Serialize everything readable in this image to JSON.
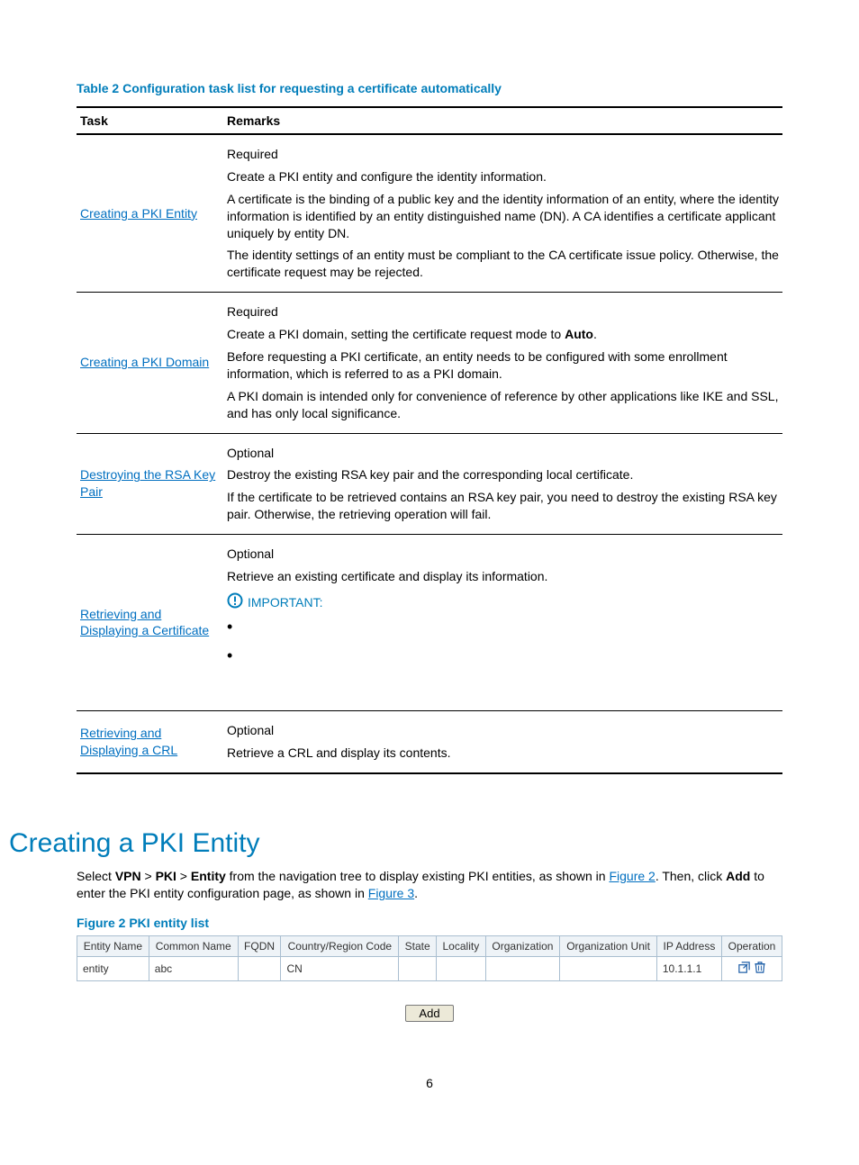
{
  "table_caption": "Table 2 Configuration task list for requesting a certificate automatically",
  "headers": {
    "task": "Task",
    "remarks": "Remarks"
  },
  "rows": {
    "r1": {
      "task": "Creating a PKI Entity",
      "p1": "Required",
      "p2": "Create a PKI entity and configure the identity information.",
      "p3": "A certificate is the binding of a public key and the identity information of an entity, where the identity information is identified by an entity distinguished name (DN). A CA identifies a certificate applicant uniquely by entity DN.",
      "p4": "The identity settings of an entity must be compliant to the CA certificate issue policy. Otherwise, the certificate request may be rejected."
    },
    "r2": {
      "task": "Creating a PKI Domain",
      "p1": "Required",
      "p2a": "Create a PKI domain, setting the certificate request mode to ",
      "p2b": "Auto",
      "p2c": ".",
      "p3": "Before requesting a PKI certificate, an entity needs to be configured with some enrollment information, which is referred to as a PKI domain.",
      "p4": "A PKI domain is intended only for convenience of reference by other applications like IKE and SSL, and has only local significance."
    },
    "r3": {
      "task": "Destroying the RSA Key Pair",
      "p1": "Optional",
      "p2": "Destroy the existing RSA key pair and the corresponding local certificate.",
      "p3": "If the certificate to be retrieved contains an RSA key pair, you need to destroy the existing RSA key pair. Otherwise, the retrieving operation will fail."
    },
    "r4": {
      "task": "Retrieving and Displaying a Certificate",
      "p1": "Optional",
      "p2": "Retrieve an existing certificate and display its information.",
      "important": "IMPORTANT:"
    },
    "r5": {
      "task": "Retrieving and Displaying a CRL",
      "p1": "Optional",
      "p2": "Retrieve a CRL and display its contents."
    }
  },
  "heading": "Creating a PKI Entity",
  "para": {
    "a": "Select ",
    "vpn": "VPN",
    "gt1": " > ",
    "pki": "PKI",
    "gt2": " > ",
    "entity": "Entity",
    "b": " from the navigation tree to display existing PKI entities, as shown in ",
    "fig2": "Figure 2",
    "c": ". Then, click ",
    "add": "Add",
    "d": " to enter the PKI entity configuration page, as shown in ",
    "fig3": "Figure 3",
    "e": "."
  },
  "figure_caption": "Figure 2 PKI entity list",
  "grid": {
    "hdr": {
      "entity_name": "Entity Name",
      "common_name": "Common Name",
      "fqdn": "FQDN",
      "country": "Country/Region Code",
      "state": "State",
      "locality": "Locality",
      "org": "Organization",
      "ou": "Organization Unit",
      "ip": "IP Address",
      "op": "Operation"
    },
    "row": {
      "entity_name": "entity",
      "common_name": "abc",
      "fqdn": "",
      "country": "CN",
      "state": "",
      "locality": "",
      "org": "",
      "ou": "",
      "ip": "10.1.1.1"
    }
  },
  "add_button": "Add",
  "page_num": "6"
}
